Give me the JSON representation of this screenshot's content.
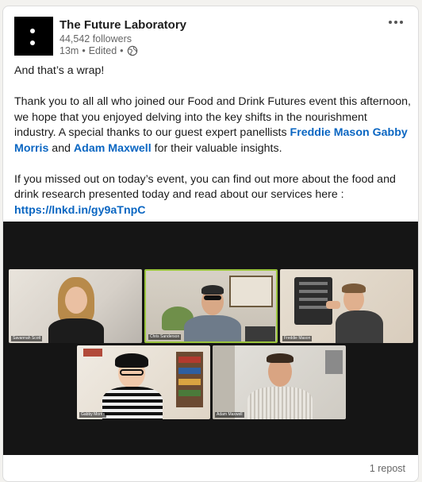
{
  "post": {
    "company_name": "The Future Laboratory",
    "followers": "44,542 followers",
    "time": "13m",
    "separator": "•",
    "edited": "Edited",
    "p1": "And that’s a wrap!",
    "p2_a": "Thank you to all all who joined our Food and Drink Futures event this afternoon, we hope that you enjoyed delving into the key shifts in the nourishment industry. A special thanks to our guest expert panellists ",
    "mention1": "Freddie Mason",
    "mention2": "Gabby Morris",
    "p2_b": " and ",
    "mention3": "Adam Maxwell",
    "p2_c": " for their valuable insights.",
    "p3_a": "If you missed out on today’s event, you can find out more about the food and drink research presented today and read about our services here : ",
    "url": "https://lnkd.in/gy9aTnpC"
  },
  "video": {
    "participants": [
      {
        "name": "Savannah Scott"
      },
      {
        "name": "Chris Sanderson"
      },
      {
        "name": "Freddie Mason"
      },
      {
        "name": "Gabby Morris"
      },
      {
        "name": "Adam Maxwell"
      }
    ]
  },
  "footer": {
    "reposts": "1 repost"
  },
  "icons": {
    "visibility": "globe-icon",
    "menu": "more-options-icon"
  },
  "colors": {
    "link": "#0a66c2",
    "logo_bg": "#000000",
    "video_bg": "#151515",
    "active_speaker": "#9bc53d"
  }
}
